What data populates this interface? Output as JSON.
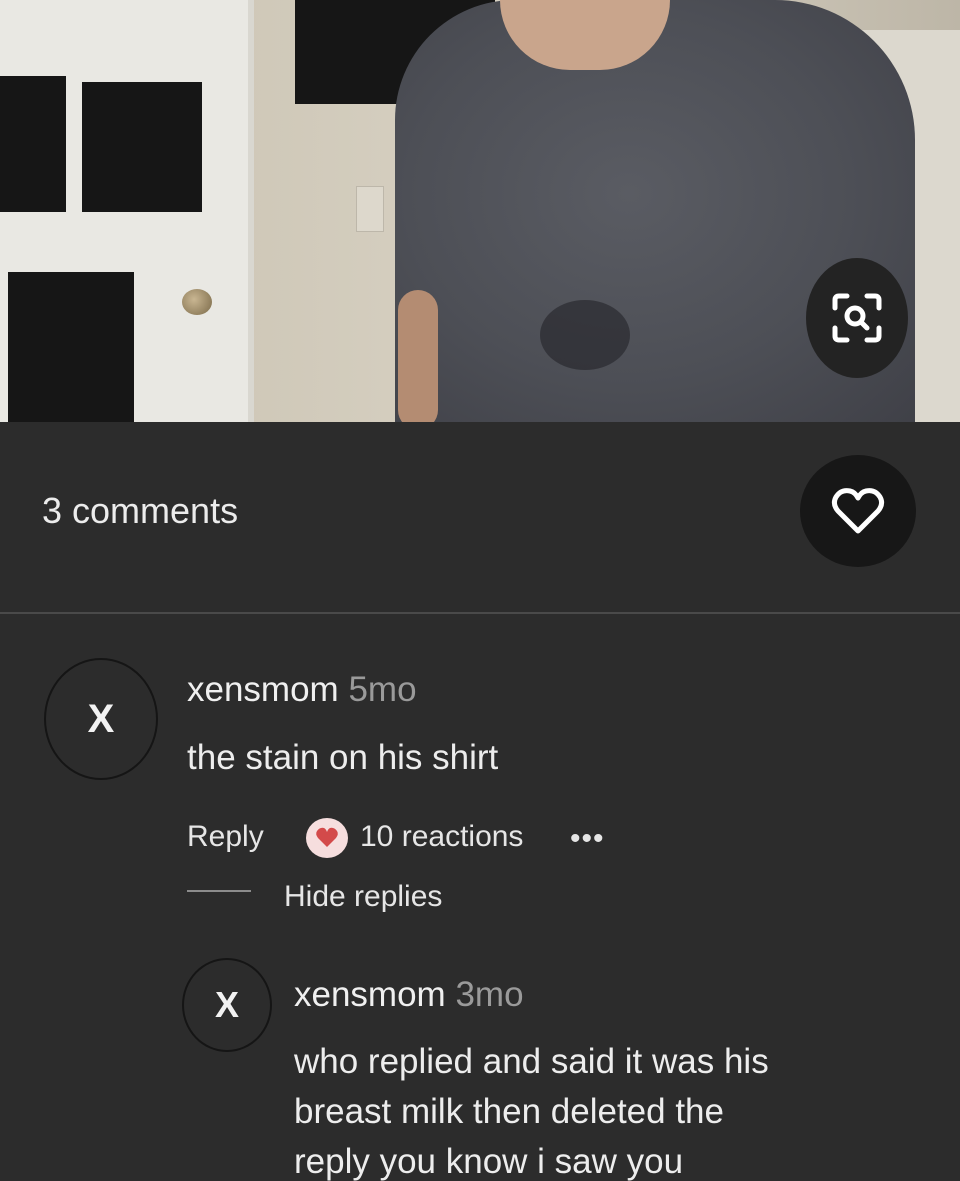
{
  "photo": {
    "lens_icon": "visual-search-icon"
  },
  "sheet": {
    "comments_count": "3 comments",
    "like_icon": "heart-icon"
  },
  "comments": [
    {
      "avatar_letter": "X",
      "username": "xensmom",
      "time": "5mo",
      "text": "the stain on his shirt",
      "reply_label": "Reply",
      "reaction_icon": "heart-reaction-icon",
      "reactions": "10 reactions",
      "more_icon": "•••",
      "hide_replies": "Hide replies"
    }
  ],
  "replies": [
    {
      "avatar_letter": "X",
      "username": "xensmom",
      "time": "3mo",
      "text_line1": "who replied and said it was his",
      "text_line2": "breast milk then deleted the",
      "text_line3": "reply you know i saw you"
    }
  ],
  "colors": {
    "background": "#2c2c2c",
    "text": "#ececec",
    "muted": "#9a9a9a",
    "button_bg": "#171717"
  }
}
